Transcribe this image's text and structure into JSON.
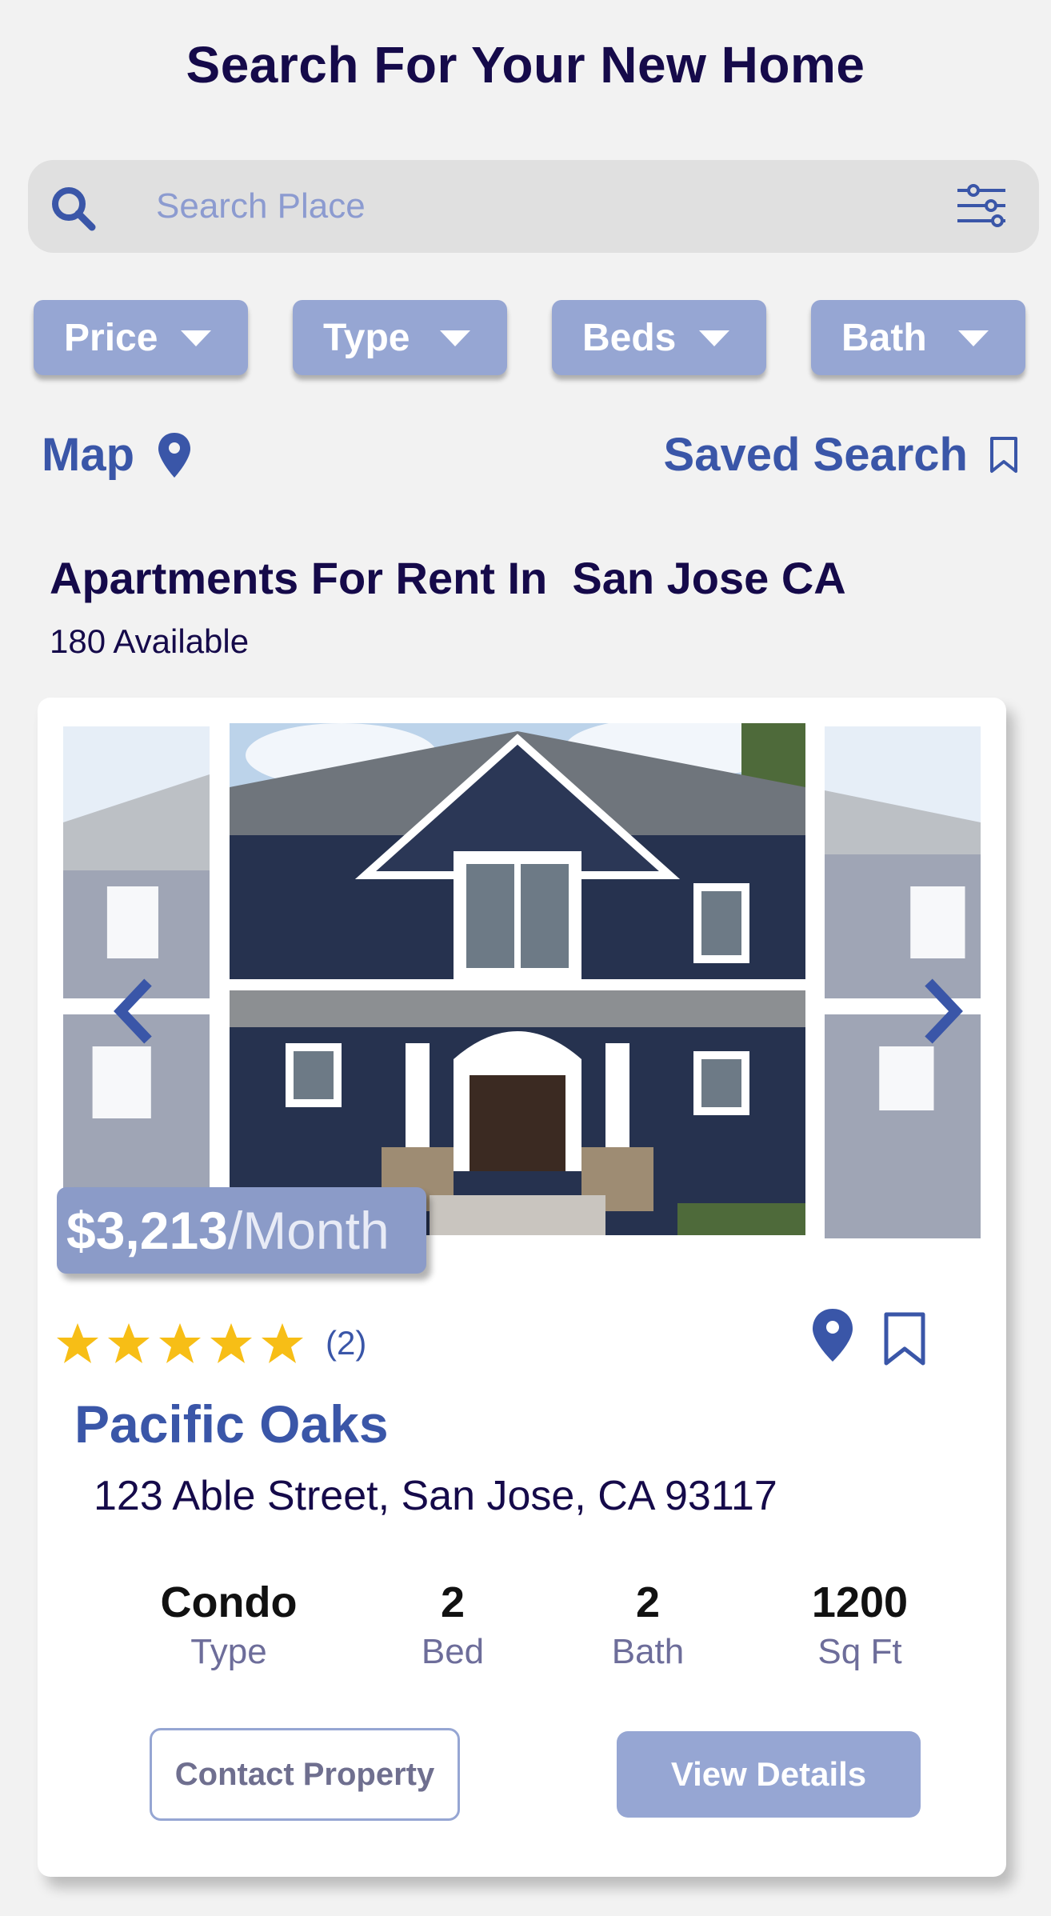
{
  "header": {
    "title": "Search For Your New Home"
  },
  "search": {
    "placeholder": "Search Place",
    "value": ""
  },
  "filters": [
    {
      "label": "Price"
    },
    {
      "label": "Type"
    },
    {
      "label": "Beds"
    },
    {
      "label": "Bath"
    }
  ],
  "nav": {
    "map_label": "Map",
    "saved_label": "Saved Search"
  },
  "results": {
    "heading": "Apartments For Rent In  San Jose CA",
    "available": "180 Available"
  },
  "listing": {
    "price": "$3,213",
    "price_unit": "/Month",
    "rating": 5,
    "review_count": "(2)",
    "name": "Pacific Oaks",
    "address": "123 Able Street, San Jose, CA 93117",
    "stats": [
      {
        "value": "Condo",
        "label": "Type"
      },
      {
        "value": "2",
        "label": "Bed"
      },
      {
        "value": "2",
        "label": "Bath"
      },
      {
        "value": "1200",
        "label": "Sq Ft"
      }
    ],
    "contact_label": "Contact Property",
    "details_label": "View Details"
  },
  "colors": {
    "accent": "#3a56a8",
    "chip": "#96a6d3",
    "title": "#150a4a",
    "star": "#f7be16"
  },
  "icons": {
    "search": "search-icon",
    "filter": "sliders-icon",
    "map": "map-pin-icon",
    "saved": "bookmark-icon",
    "prev": "chevron-left-icon",
    "next": "chevron-right-icon",
    "star": "star-icon"
  }
}
